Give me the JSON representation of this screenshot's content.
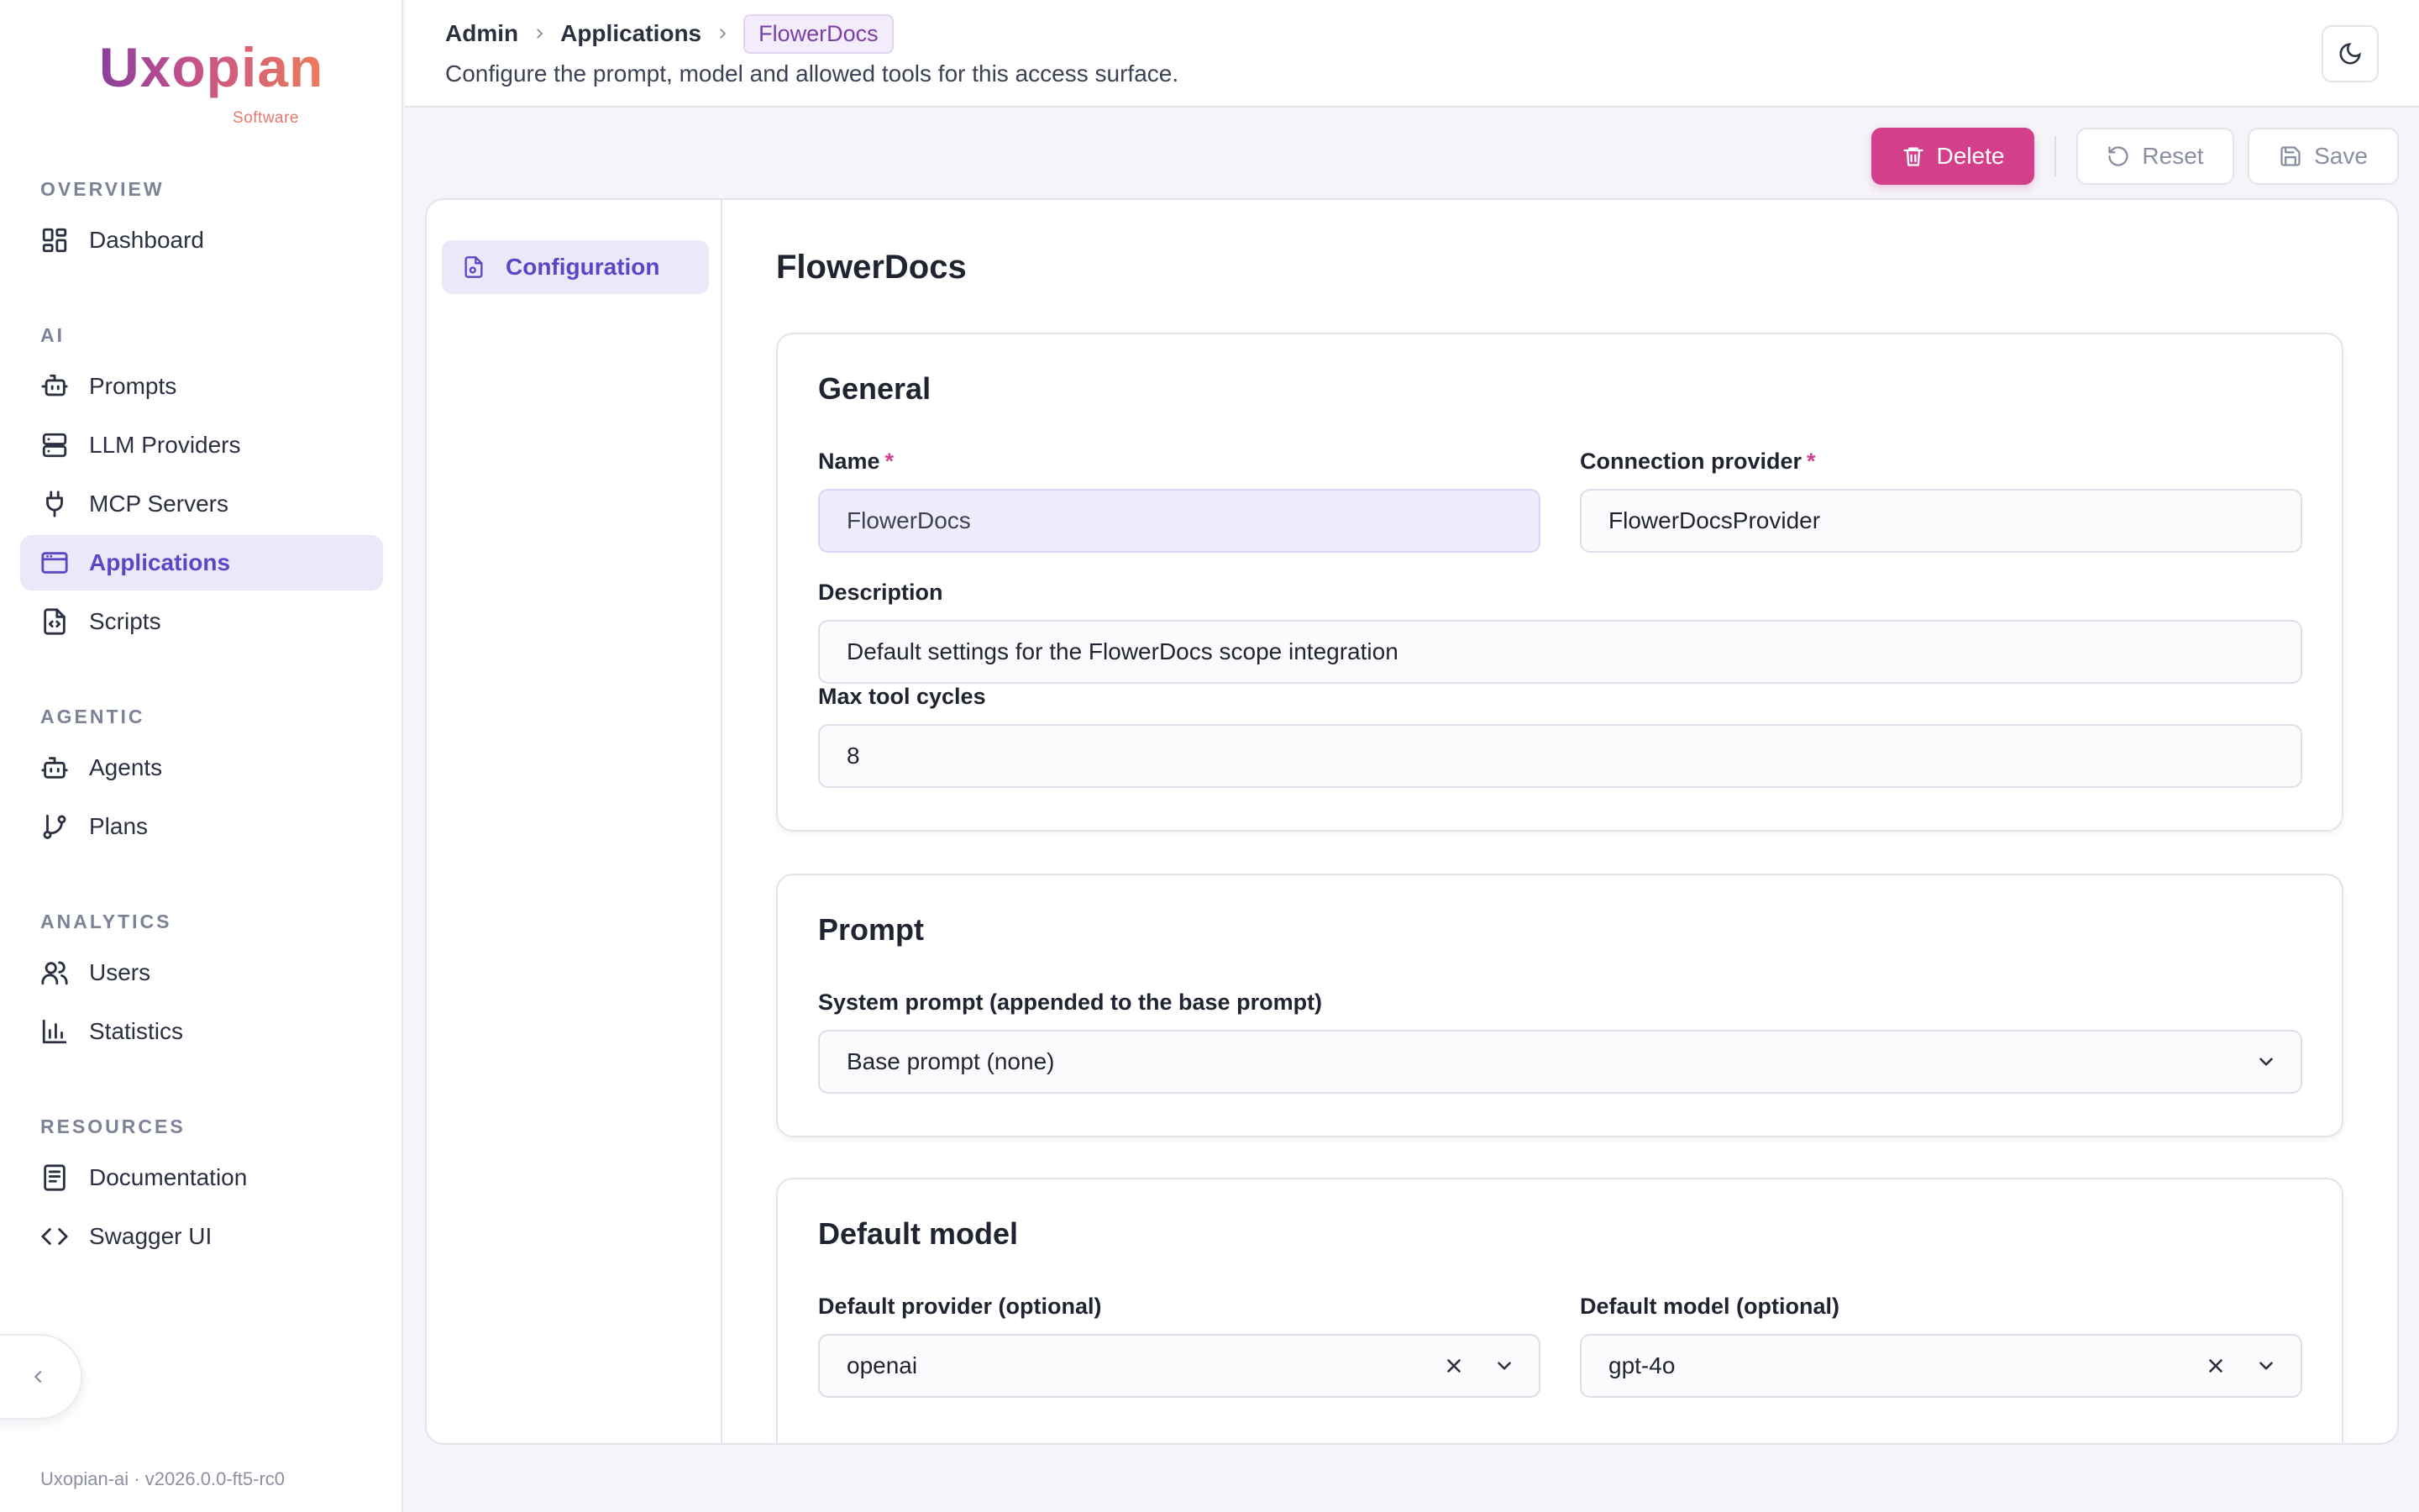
{
  "sidebar": {
    "logo": {
      "word": "Uxopian",
      "sub": "Software"
    },
    "sections": {
      "overview": "OVERVIEW",
      "ai": "AI",
      "agentic": "AGENTIC",
      "analytics": "ANALYTICS",
      "resources": "RESOURCES"
    },
    "items": {
      "dashboard": "Dashboard",
      "prompts": "Prompts",
      "llm_providers": "LLM Providers",
      "mcp_servers": "MCP Servers",
      "applications": "Applications",
      "scripts": "Scripts",
      "agents": "Agents",
      "plans": "Plans",
      "users": "Users",
      "statistics": "Statistics",
      "documentation": "Documentation",
      "swagger": "Swagger UI"
    },
    "active_item": "applications",
    "version": "Uxopian-ai · v2026.0.0-ft5-rc0"
  },
  "header": {
    "breadcrumb": [
      "Admin",
      "Applications",
      "FlowerDocs"
    ],
    "subtitle": "Configure the prompt, model and allowed tools for this access surface."
  },
  "toolbar": {
    "delete_label": "Delete",
    "reset_label": "Reset",
    "save_label": "Save"
  },
  "panel": {
    "tab_label": "Configuration",
    "title": "FlowerDocs",
    "general": {
      "title": "General",
      "name_label": "Name",
      "name_value": "FlowerDocs",
      "connection_label": "Connection provider",
      "connection_value": "FlowerDocsProvider",
      "description_label": "Description",
      "description_value": "Default settings for the FlowerDocs scope integration",
      "max_cycles_label": "Max tool cycles",
      "max_cycles_value": "8",
      "required_mark": "*"
    },
    "prompt": {
      "title": "Prompt",
      "system_label": "System prompt (appended to the base prompt)",
      "system_value": "Base prompt (none)"
    },
    "default_model": {
      "title": "Default model",
      "provider_label": "Default provider (optional)",
      "provider_value": "openai",
      "model_label": "Default model (optional)",
      "model_value": "gpt-4o"
    }
  },
  "colors": {
    "accent": "#5b47c6",
    "danger": "#d33f8a",
    "active_bg": "#ebe8f9"
  }
}
